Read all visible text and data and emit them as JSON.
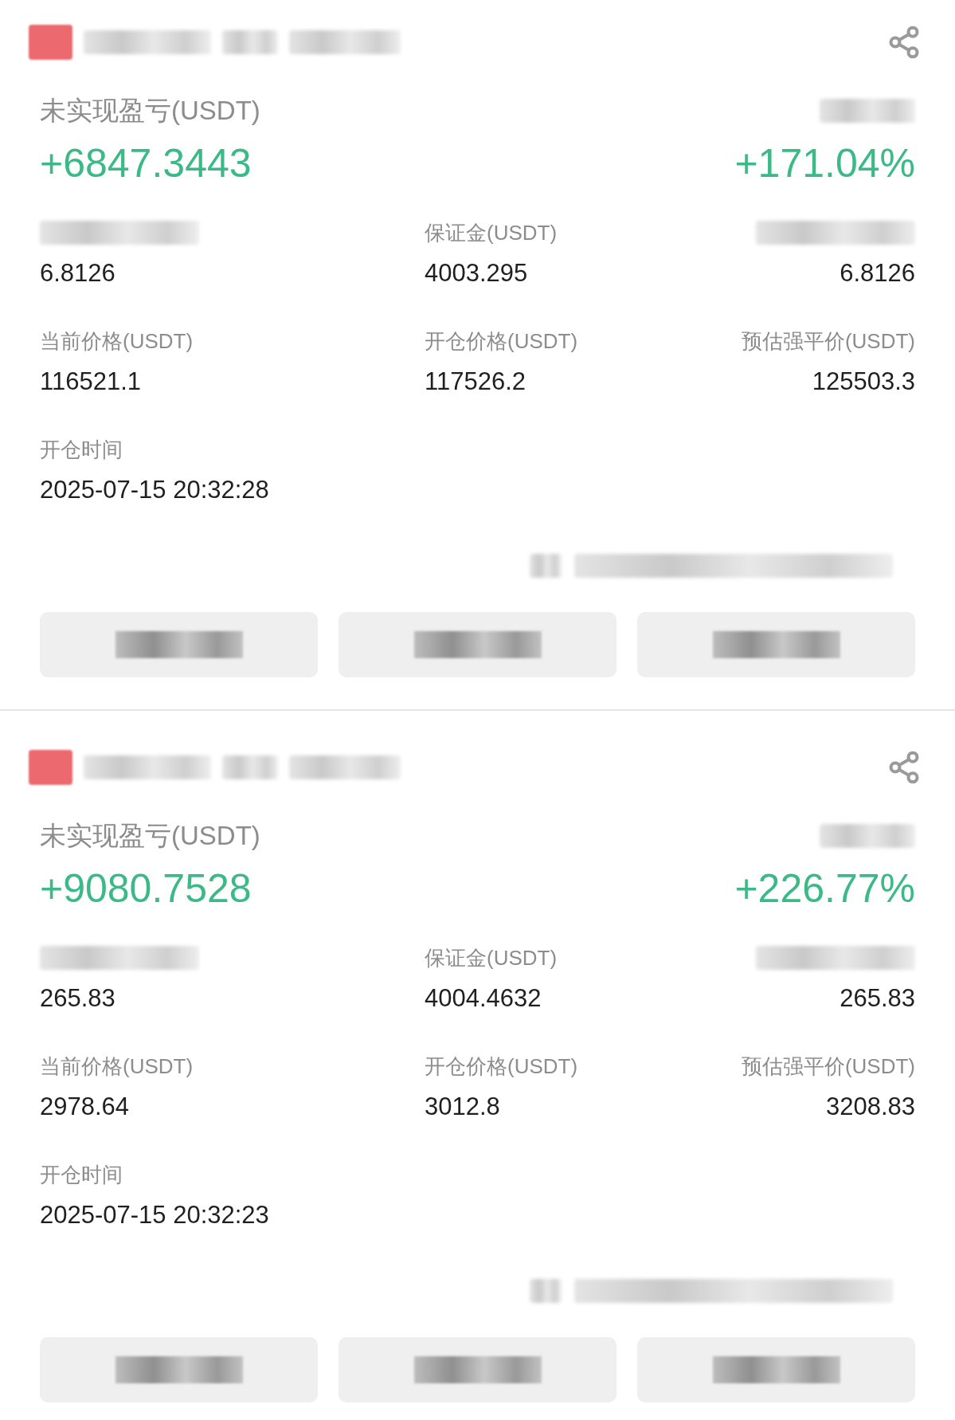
{
  "positions": [
    {
      "pnl_label": "未实现盈亏(USDT)",
      "pnl": "+6847.3443",
      "roi": "+171.04%",
      "fields": [
        {
          "kind": "redacted",
          "value": "6.8126"
        },
        {
          "kind": "labeled",
          "label": "保证金(USDT)",
          "value": "4003.295"
        },
        {
          "kind": "redacted",
          "value": "6.8126"
        },
        {
          "kind": "labeled",
          "label": "当前价格(USDT)",
          "value": "116521.1"
        },
        {
          "kind": "labeled",
          "label": "开仓价格(USDT)",
          "value": "117526.2"
        },
        {
          "kind": "labeled",
          "label": "预估强平价(USDT)",
          "value": "125503.3"
        },
        {
          "kind": "labeled",
          "label": "开仓时间",
          "value": "2025-07-15 20:32:28"
        }
      ]
    },
    {
      "pnl_label": "未实现盈亏(USDT)",
      "pnl": "+9080.7528",
      "roi": "+226.77%",
      "fields": [
        {
          "kind": "redacted",
          "value": "265.83"
        },
        {
          "kind": "labeled",
          "label": "保证金(USDT)",
          "value": "4004.4632"
        },
        {
          "kind": "redacted",
          "value": "265.83"
        },
        {
          "kind": "labeled",
          "label": "当前价格(USDT)",
          "value": "2978.64"
        },
        {
          "kind": "labeled",
          "label": "开仓价格(USDT)",
          "value": "3012.8"
        },
        {
          "kind": "labeled",
          "label": "预估强平价(USDT)",
          "value": "3208.83"
        },
        {
          "kind": "labeled",
          "label": "开仓时间",
          "value": "2025-07-15 20:32:23"
        }
      ]
    }
  ]
}
